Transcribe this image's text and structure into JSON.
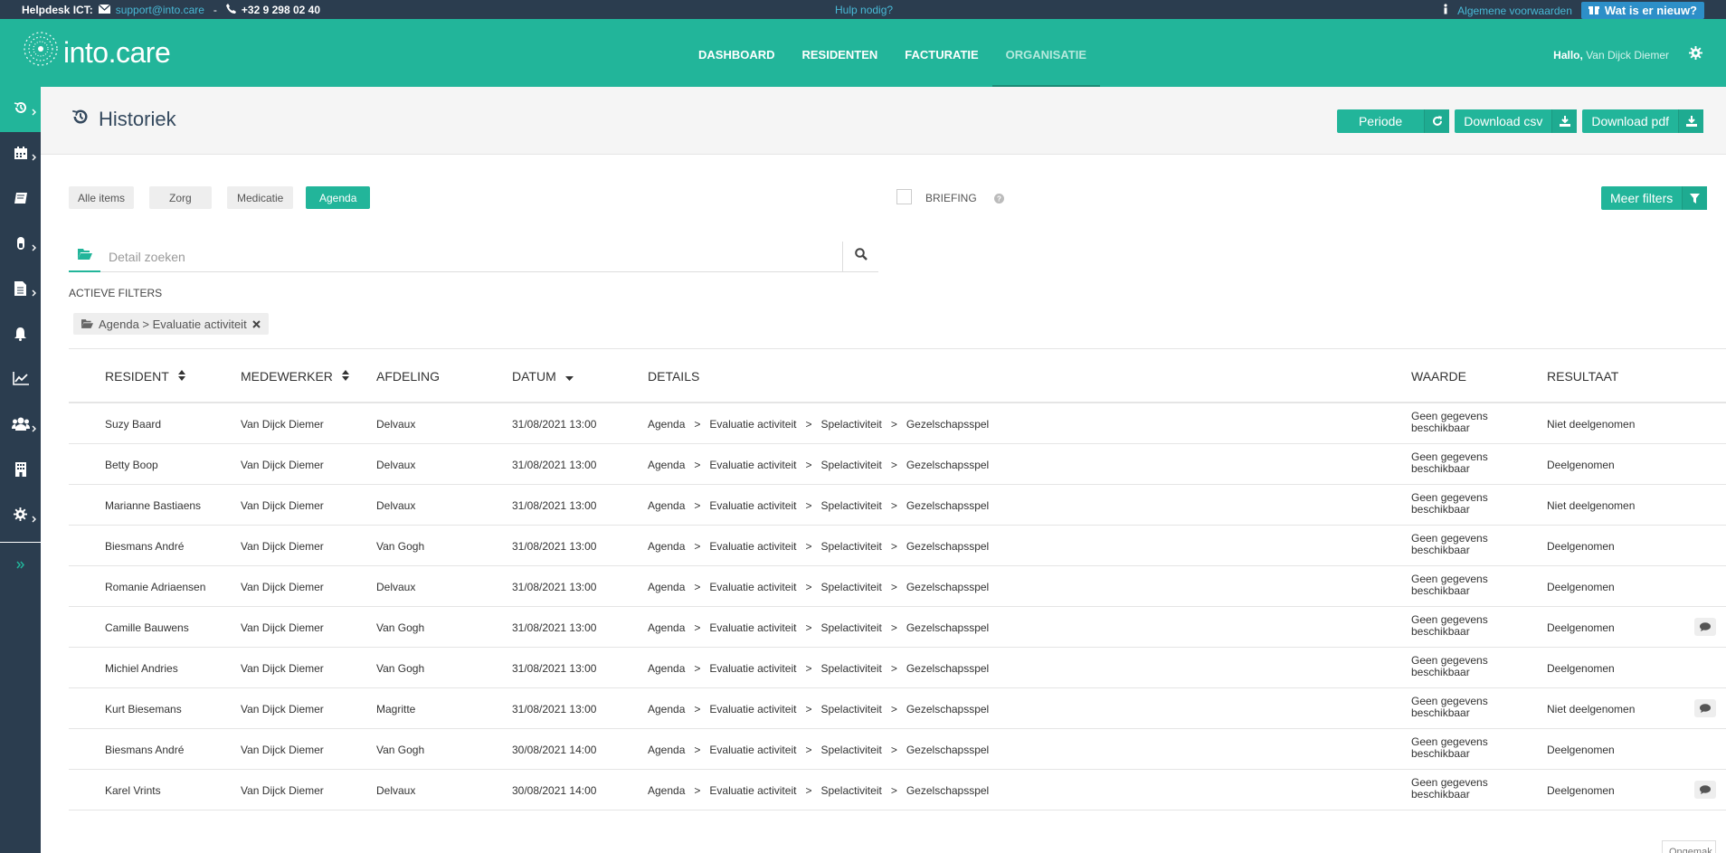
{
  "topbar": {
    "helpdesk_label": "Helpdesk ICT:",
    "email": "support@into.care",
    "separator": "-",
    "phone": "+32 9 298 02 40",
    "help": "Hulp nodig?",
    "terms": "Algemene voorwaarden",
    "whats_new": "Wat is er nieuw?"
  },
  "header": {
    "logo_text": "into.care",
    "nav": [
      "DASHBOARD",
      "RESIDENTEN",
      "FACTURATIE",
      "ORGANISATIE"
    ],
    "active_nav": "ORGANISATIE",
    "greeting": "Hallo,",
    "user_name": "Van Dijck Diemer"
  },
  "sidebar": {
    "items": [
      "history-icon",
      "calendar-icon",
      "book-icon",
      "pill-icon",
      "file-icon",
      "bell-icon",
      "chart-icon",
      "users-icon",
      "building-icon",
      "gear-icon"
    ],
    "expand": "double-chevron-icon"
  },
  "page": {
    "title": "Historiek",
    "buttons": {
      "periode": "Periode",
      "download_csv": "Download csv",
      "download_pdf": "Download pdf"
    }
  },
  "filters": {
    "chips": [
      "Alle items",
      "Zorg",
      "Medicatie",
      "Agenda"
    ],
    "active_chip": "Agenda",
    "briefing": "BRIEFING",
    "more_filters": "Meer filters",
    "search_placeholder": "Detail zoeken",
    "active_filters_label": "ACTIEVE FILTERS",
    "active_filter_tag": "Agenda > Evaluatie activiteit"
  },
  "table": {
    "headers": [
      "RESIDENT",
      "MEDEWERKER",
      "AFDELING",
      "DATUM",
      "DETAILS",
      "WAARDE",
      "RESULTAAT"
    ],
    "rows": [
      {
        "resident": "Suzy Baard",
        "medewerker": "Van Dijck Diemer",
        "afdeling": "Delvaux",
        "datum": "31/08/2021 13:00",
        "details": [
          "Agenda",
          "Evaluatie activiteit",
          "Spelactiviteit",
          "Gezelschapsspel"
        ],
        "waarde": "Geen gegevens beschikbaar",
        "resultaat": "Niet deelgenomen",
        "comment": false
      },
      {
        "resident": "Betty Boop",
        "medewerker": "Van Dijck Diemer",
        "afdeling": "Delvaux",
        "datum": "31/08/2021 13:00",
        "details": [
          "Agenda",
          "Evaluatie activiteit",
          "Spelactiviteit",
          "Gezelschapsspel"
        ],
        "waarde": "Geen gegevens beschikbaar",
        "resultaat": "Deelgenomen",
        "comment": false
      },
      {
        "resident": "Marianne Bastiaens",
        "medewerker": "Van Dijck Diemer",
        "afdeling": "Delvaux",
        "datum": "31/08/2021 13:00",
        "details": [
          "Agenda",
          "Evaluatie activiteit",
          "Spelactiviteit",
          "Gezelschapsspel"
        ],
        "waarde": "Geen gegevens beschikbaar",
        "resultaat": "Niet deelgenomen",
        "comment": false
      },
      {
        "resident": "Biesmans André",
        "medewerker": "Van Dijck Diemer",
        "afdeling": "Van Gogh",
        "datum": "31/08/2021 13:00",
        "details": [
          "Agenda",
          "Evaluatie activiteit",
          "Spelactiviteit",
          "Gezelschapsspel"
        ],
        "waarde": "Geen gegevens beschikbaar",
        "resultaat": "Deelgenomen",
        "comment": false
      },
      {
        "resident": "Romanie Adriaensen",
        "medewerker": "Van Dijck Diemer",
        "afdeling": "Delvaux",
        "datum": "31/08/2021 13:00",
        "details": [
          "Agenda",
          "Evaluatie activiteit",
          "Spelactiviteit",
          "Gezelschapsspel"
        ],
        "waarde": "Geen gegevens beschikbaar",
        "resultaat": "Deelgenomen",
        "comment": false
      },
      {
        "resident": "Camille Bauwens",
        "medewerker": "Van Dijck Diemer",
        "afdeling": "Van Gogh",
        "datum": "31/08/2021 13:00",
        "details": [
          "Agenda",
          "Evaluatie activiteit",
          "Spelactiviteit",
          "Gezelschapsspel"
        ],
        "waarde": "Geen gegevens beschikbaar",
        "resultaat": "Deelgenomen",
        "comment": true
      },
      {
        "resident": "Michiel Andries",
        "medewerker": "Van Dijck Diemer",
        "afdeling": "Van Gogh",
        "datum": "31/08/2021 13:00",
        "details": [
          "Agenda",
          "Evaluatie activiteit",
          "Spelactiviteit",
          "Gezelschapsspel"
        ],
        "waarde": "Geen gegevens beschikbaar",
        "resultaat": "Deelgenomen",
        "comment": false
      },
      {
        "resident": "Kurt Biesemans",
        "medewerker": "Van Dijck Diemer",
        "afdeling": "Magritte",
        "datum": "31/08/2021 13:00",
        "details": [
          "Agenda",
          "Evaluatie activiteit",
          "Spelactiviteit",
          "Gezelschapsspel"
        ],
        "waarde": "Geen gegevens beschikbaar",
        "resultaat": "Niet deelgenomen",
        "comment": true
      },
      {
        "resident": "Biesmans André",
        "medewerker": "Van Dijck Diemer",
        "afdeling": "Van Gogh",
        "datum": "30/08/2021 14:00",
        "details": [
          "Agenda",
          "Evaluatie activiteit",
          "Spelactiviteit",
          "Gezelschapsspel"
        ],
        "waarde": "Geen gegevens beschikbaar",
        "resultaat": "Deelgenomen",
        "comment": false
      },
      {
        "resident": "Karel Vrints",
        "medewerker": "Van Dijck Diemer",
        "afdeling": "Delvaux",
        "datum": "30/08/2021 14:00",
        "details": [
          "Agenda",
          "Evaluatie activiteit",
          "Spelactiviteit",
          "Gezelschapsspel"
        ],
        "waarde": "Geen gegevens beschikbaar",
        "resultaat": "Deelgenomen",
        "comment": true
      }
    ]
  },
  "footer": {
    "ongemak": "Ongemak"
  },
  "colors": {
    "brand": "#22b59a",
    "dark": "#2b3d4f",
    "link": "#49b9d6"
  }
}
